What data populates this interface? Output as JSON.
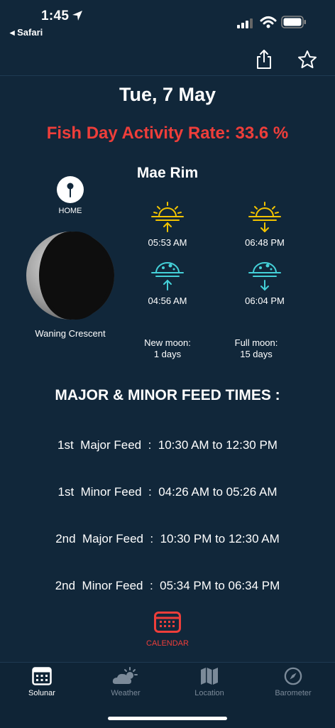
{
  "status": {
    "time": "1:45",
    "back_label": "◂ Safari"
  },
  "header": {
    "date": "Tue, 7 May",
    "fish_rate": "Fish Day Activity Rate: 33.6 %"
  },
  "location": {
    "name": "Mae Rim",
    "home_label": "HOME"
  },
  "moon": {
    "phase": "Waning Crescent",
    "new_moon": [
      "New moon:",
      "1 days"
    ],
    "full_moon": [
      "Full moon:",
      "15 days"
    ]
  },
  "times": {
    "sunrise": "05:53 AM",
    "sunset": "06:48 PM",
    "moonrise": "04:56 AM",
    "moonset": "06:04 PM"
  },
  "feeds": {
    "title": "MAJOR & MINOR FEED TIMES :",
    "items": [
      "1st  Major Feed  :  10:30 AM to 12:30 PM",
      "1st  Minor Feed  :  04:26 AM to 05:26 AM",
      "2nd  Major Feed  :  10:30 PM to 12:30 AM",
      "2nd  Minor Feed  :  05:34 PM to 06:34 PM"
    ]
  },
  "calendar": {
    "label": "CALENDAR"
  },
  "tabs": [
    {
      "label": "Solunar",
      "icon": "calendar-icon",
      "active": true
    },
    {
      "label": "Weather",
      "icon": "cloud-sun-icon",
      "active": false
    },
    {
      "label": "Location",
      "icon": "map-icon",
      "active": false
    },
    {
      "label": "Barometer",
      "icon": "compass-icon",
      "active": false
    }
  ],
  "colors": {
    "background": "#11273a",
    "accent_red": "#ee3e3a",
    "sun_yellow": "#f2c400",
    "moon_cyan": "#44d0d8"
  }
}
